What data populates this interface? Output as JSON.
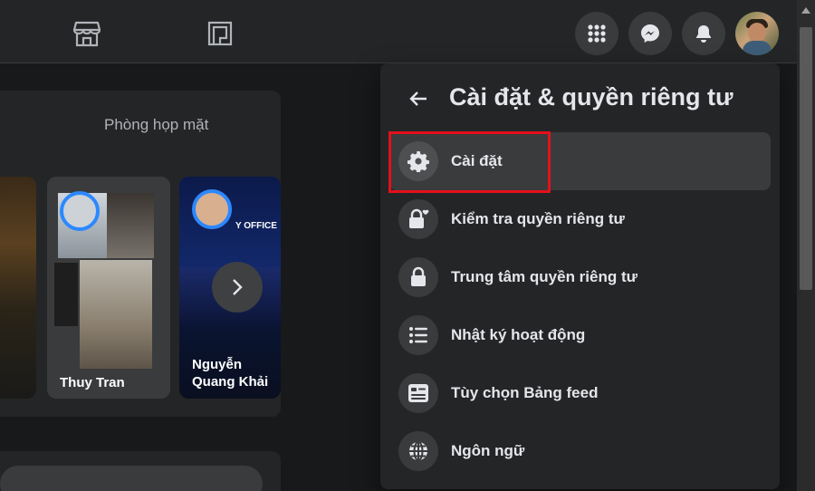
{
  "colors": {
    "panel_bg": "#242526",
    "icon_bg": "#3a3b3c",
    "text": "#e4e6eb",
    "highlight_border": "#e3101c",
    "story_ring": "#2d88ff"
  },
  "topbar": {
    "icons": [
      "marketplace-icon",
      "gaming-icon",
      "menu-grid-icon",
      "messenger-icon",
      "notifications-icon"
    ]
  },
  "feed": {
    "room_tab": "Phòng họp mặt",
    "stories": [
      {
        "name": "Thuy Tran",
        "overlay_text": ""
      },
      {
        "name": "Nguyễn\nQuang Khải",
        "overlay_text": "Y OFFICE"
      }
    ]
  },
  "panel": {
    "title": "Cài đặt & quyền riêng tư",
    "items": [
      {
        "label": "Cài đặt",
        "icon": "gear-icon"
      },
      {
        "label": "Kiểm tra quyền riêng tư",
        "icon": "lock-heart-icon"
      },
      {
        "label": "Trung tâm quyền riêng tư",
        "icon": "lock-icon"
      },
      {
        "label": "Nhật ký hoạt động",
        "icon": "list-icon"
      },
      {
        "label": "Tùy chọn Bảng feed",
        "icon": "feed-preferences-icon"
      },
      {
        "label": "Ngôn ngữ",
        "icon": "globe-icon"
      }
    ]
  }
}
